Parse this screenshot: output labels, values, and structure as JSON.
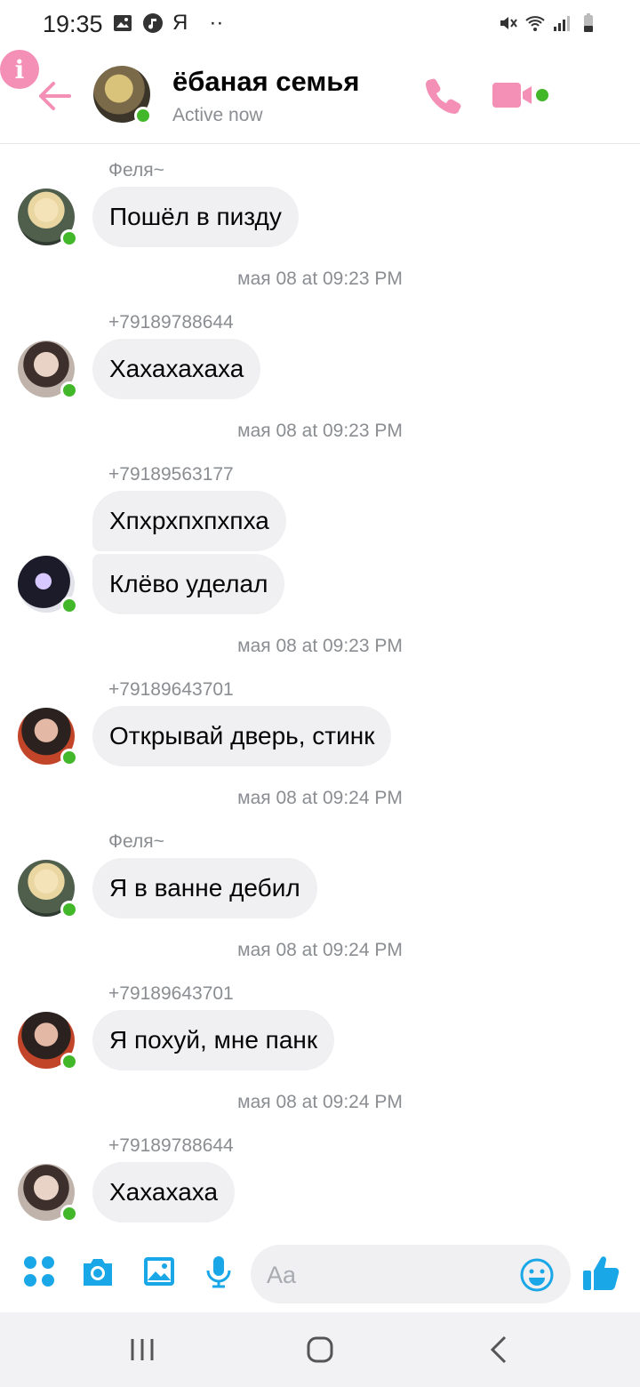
{
  "status_bar": {
    "time": "19:35",
    "keyboard_indicator": "Я",
    "more": "··",
    "icons": [
      "gallery-icon",
      "music-icon",
      "mute-icon",
      "wifi-icon",
      "signal-icon",
      "battery-icon"
    ]
  },
  "header": {
    "title": "ёбаная семья",
    "status": "Active now",
    "accent_color": "#f48fb5",
    "online_color": "#42b72a"
  },
  "messages": [
    {
      "sender": "Феля~",
      "bubbles": [
        "Пошёл в пизду"
      ],
      "timestamp": "мая 08 at 09:23 PM"
    },
    {
      "sender": "+79189788644",
      "bubbles": [
        "Хахахахаха"
      ],
      "timestamp": "мая 08 at 09:23 PM"
    },
    {
      "sender": "+79189563177",
      "bubbles": [
        "Хпхрхпхпхпха",
        "Клёво уделал"
      ],
      "timestamp": "мая 08 at 09:23 PM"
    },
    {
      "sender": "+79189643701",
      "bubbles": [
        "Открывай дверь, стинк"
      ],
      "timestamp": "мая 08 at 09:24 PM"
    },
    {
      "sender": "Феля~",
      "bubbles": [
        "Я в ванне дебил"
      ],
      "timestamp": "мая 08 at 09:24 PM"
    },
    {
      "sender": "+79189643701",
      "bubbles": [
        "Я похуй, мне панк"
      ],
      "timestamp": "мая 08 at 09:24 PM"
    },
    {
      "sender": "+79189788644",
      "bubbles": [
        "Хахахаха"
      ]
    }
  ],
  "composer": {
    "placeholder": "Aa",
    "icon_color": "#1aa7e8"
  }
}
